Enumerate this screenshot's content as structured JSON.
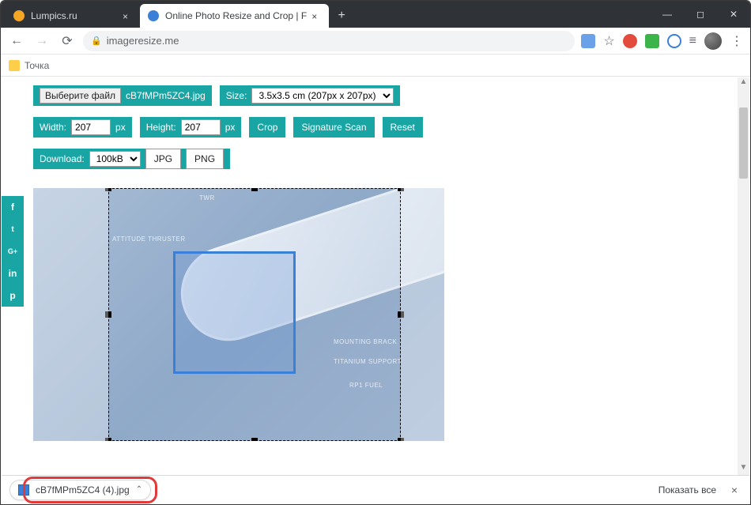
{
  "tabs": {
    "inactive": {
      "title": "Lumpics.ru",
      "favicon": "#f5a623"
    },
    "active": {
      "title": "Online Photo Resize and Crop | F",
      "favicon": "#3a7fd8"
    }
  },
  "win": {
    "min": "—",
    "max": "◻",
    "close": "✕"
  },
  "addr": {
    "host": "imageresize.me"
  },
  "bookmarks": {
    "item1": "Точка"
  },
  "controls": {
    "choose_btn": "Выберите файл",
    "filename": "cB7fMPm5ZC4.jpg",
    "size_label": "Size:",
    "size_option": "3.5x3.5 cm (207px x 207px)",
    "width_label": "Width:",
    "width_value": "207",
    "px1": "px",
    "height_label": "Height:",
    "height_value": "207",
    "px2": "px",
    "crop": "Crop",
    "sigscan": "Signature Scan",
    "reset": "Reset",
    "dl_label": "Download:",
    "dl_size_option": "100kB",
    "jpg": "JPG",
    "png": "PNG"
  },
  "social": {
    "fb": "f",
    "tw": "t",
    "gp": "G+",
    "in": "in",
    "pin": "p"
  },
  "img_labels": {
    "twr": "TWR",
    "thruster": "ATTITUDE THRUSTER",
    "mount": "MOUNTING BRACK",
    "titanium": "TITANIUM SUPPORT",
    "fuel": "RP1 FUEL"
  },
  "dl": {
    "filename": "cB7fMPm5ZC4 (4).jpg",
    "showall": "Показать все"
  }
}
